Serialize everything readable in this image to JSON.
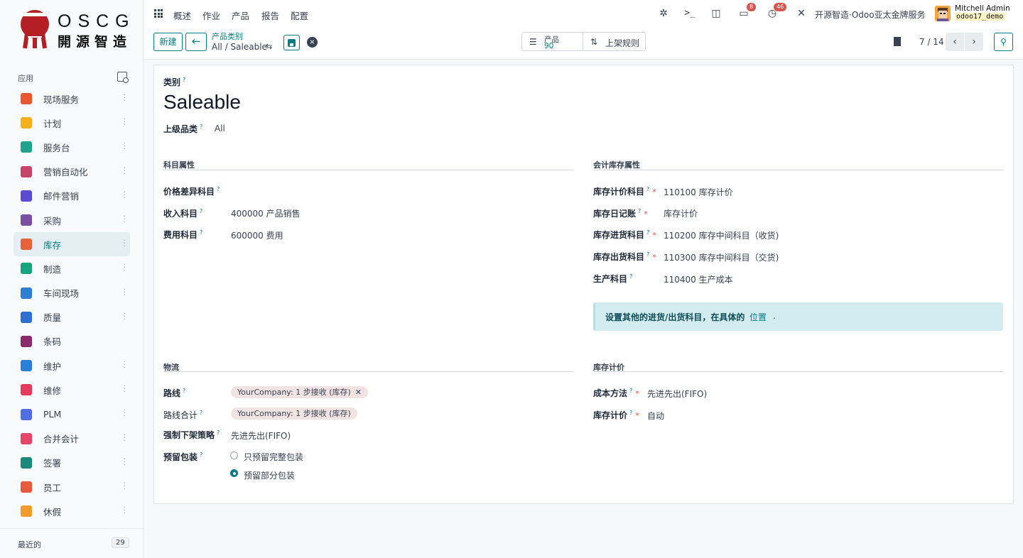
{
  "logo": {
    "en": "OSCG",
    "cn": "開源智造"
  },
  "sidebar": {
    "apps_heading": "应用",
    "items": [
      {
        "label": "现场服务",
        "color": "#e8572f"
      },
      {
        "label": "计划",
        "color": "#f4b01f"
      },
      {
        "label": "服务台",
        "color": "#1fa38d"
      },
      {
        "label": "营销自动化",
        "color": "#c7456a"
      },
      {
        "label": "邮件营销",
        "color": "#5b4bd1"
      },
      {
        "label": "采购",
        "color": "#7a4f9e"
      },
      {
        "label": "库存",
        "color": "#e6603a",
        "active": true
      },
      {
        "label": "制造",
        "color": "#17a37d"
      },
      {
        "label": "车间现场",
        "color": "#2d7fd2"
      },
      {
        "label": "质量",
        "color": "#2e6fd0"
      },
      {
        "label": "条码",
        "color": "#8a2b6b"
      },
      {
        "label": "维护",
        "color": "#2a80d8"
      },
      {
        "label": "维修",
        "color": "#e23c5f"
      },
      {
        "label": "PLM",
        "color": "#4f6fe0"
      },
      {
        "label": "合并会计",
        "color": "#e5476a"
      },
      {
        "label": "签署",
        "color": "#1b8a7c"
      },
      {
        "label": "员工",
        "color": "#e65b3d"
      },
      {
        "label": "休假",
        "color": "#f09c2a"
      }
    ],
    "recent_label": "最近的",
    "recent_count": "29"
  },
  "topnav": {
    "menu": [
      "概述",
      "作业",
      "产品",
      "报告",
      "配置"
    ],
    "messages_badge": "8",
    "activities_badge": "46",
    "company": "开源智造·Odoo亚太金牌服务",
    "user_name": "Mitchell Admin",
    "db_name": "odoo17_demo"
  },
  "control": {
    "new_label": "新建",
    "breadcrumb_parent": "产品类别",
    "breadcrumb_current": "All / Saleable",
    "smart_products_label": "产品",
    "smart_products_value": "90",
    "smart_putaway_label": "上架规则",
    "pager": "7 / 14"
  },
  "form": {
    "category_label": "类别",
    "name": "Saleable",
    "parent_label": "上级品类",
    "parent_value": "All",
    "account_section": "科目属性",
    "price_diff_label": "价格差异科目",
    "income_label": "收入科目",
    "income_value": "400000 产品销售",
    "expense_label": "费用科目",
    "expense_value": "600000 费用",
    "stock_account_section": "会计库存属性",
    "valuation_account_label": "库存计价科目",
    "valuation_account_value": "110100 库存计价",
    "stock_journal_label": "库存日记账",
    "stock_journal_value": "库存计价",
    "stock_input_label": "库存进货科目",
    "stock_input_value": "110200 库存中间科目（收货)",
    "stock_output_label": "库存出货科目",
    "stock_output_value": "110300 库存中间科目（交货)",
    "production_label": "生产科目",
    "production_value": "110400 生产成本",
    "alert_text": "设置其他的进货/出货科目，在具体的",
    "alert_link": "位置",
    "alert_end": ".",
    "logistics_section": "物流",
    "routes_label": "路线",
    "routes_tag": "YourCompany: 1 步接收 (库存)",
    "total_routes_label": "路线合计",
    "total_routes_tag": "YourCompany: 1 步接收 (库存)",
    "removal_label": "强制下架策略",
    "removal_value": "先进先出(FIFO)",
    "packaging_label": "预留包装",
    "packaging_opt1": "只预留完整包装",
    "packaging_opt2": "预留部分包装",
    "valuation_section": "库存计价",
    "cost_method_label": "成本方法",
    "cost_method_value": "先进先出(FIFO)",
    "inventory_valuation_label": "库存计价",
    "inventory_valuation_value": "自动"
  }
}
